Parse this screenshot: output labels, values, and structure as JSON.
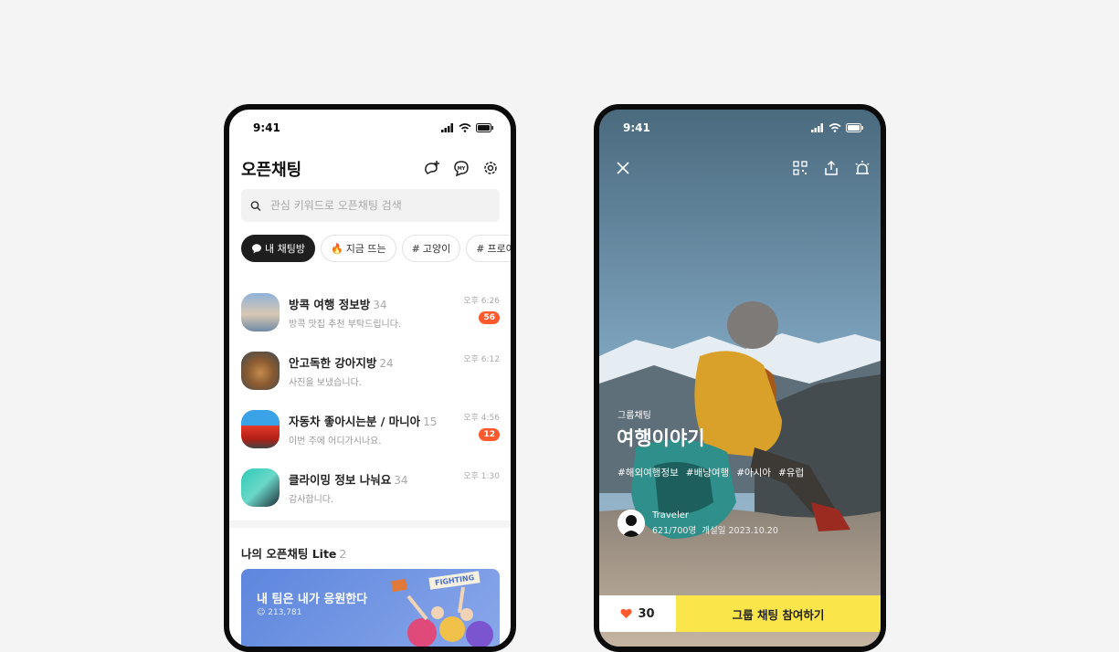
{
  "left_phone": {
    "status": {
      "time": "9:41"
    },
    "title": "오픈채팅",
    "header_icons": [
      "add-chat-icon",
      "my-profile-icon",
      "settings-icon"
    ],
    "search": {
      "placeholder": "관심 키워드로 오픈채팅 검색"
    },
    "chips": [
      {
        "label": "내 채팅방",
        "icon": "chat-bubble-icon",
        "active": true
      },
      {
        "label": "지금 뜨는",
        "icon": "fire-icon",
        "active": false
      },
      {
        "label": "고양이",
        "icon": "hash-icon",
        "active": false
      },
      {
        "label": "프로야구",
        "icon": "hash-icon",
        "active": false
      }
    ],
    "chats": [
      {
        "name": "방콕 여행 정보방",
        "count": "34",
        "message": "방콕 맛집 추천 부탁드립니다.",
        "time": "오후 6:26",
        "badge": "56"
      },
      {
        "name": "안고독한 강아지방",
        "count": "24",
        "message": "사진을 보냈습니다.",
        "time": "오후 6:12",
        "badge": ""
      },
      {
        "name": "자동차 좋아시는분 / 마니아",
        "count": "15",
        "message": "이번 주에 어디가시나요.",
        "time": "오후 4:56",
        "badge": "12"
      },
      {
        "name": "클라이밍 정보 나눠요",
        "count": "34",
        "message": "감사합니다.",
        "time": "오후 1:30",
        "badge": ""
      }
    ],
    "lite": {
      "title": "나의 오픈채팅 Lite",
      "count": "2"
    },
    "banner": {
      "title": "내 팀은 내가 응원한다",
      "members": "213,781",
      "sign": "FIGHTING"
    }
  },
  "right_phone": {
    "status": {
      "time": "9:41"
    },
    "header_icons": [
      "close-icon",
      "qr-code-icon",
      "share-icon",
      "report-siren-icon"
    ],
    "group_label": "그룹채팅",
    "group_title": "여행이야기",
    "tags": [
      "#해외여행정보",
      "#배낭여행",
      "#아시아",
      "#유럽"
    ],
    "owner": {
      "name": "Traveler",
      "members": "621/700명",
      "opened": "개설일 2023.10.20"
    },
    "likes": "30",
    "join_label": "그룹 채팅 참여하기"
  },
  "colors": {
    "badge": "#ff5a2d",
    "join": "#fae54b",
    "heart": "#ff5a2d"
  }
}
